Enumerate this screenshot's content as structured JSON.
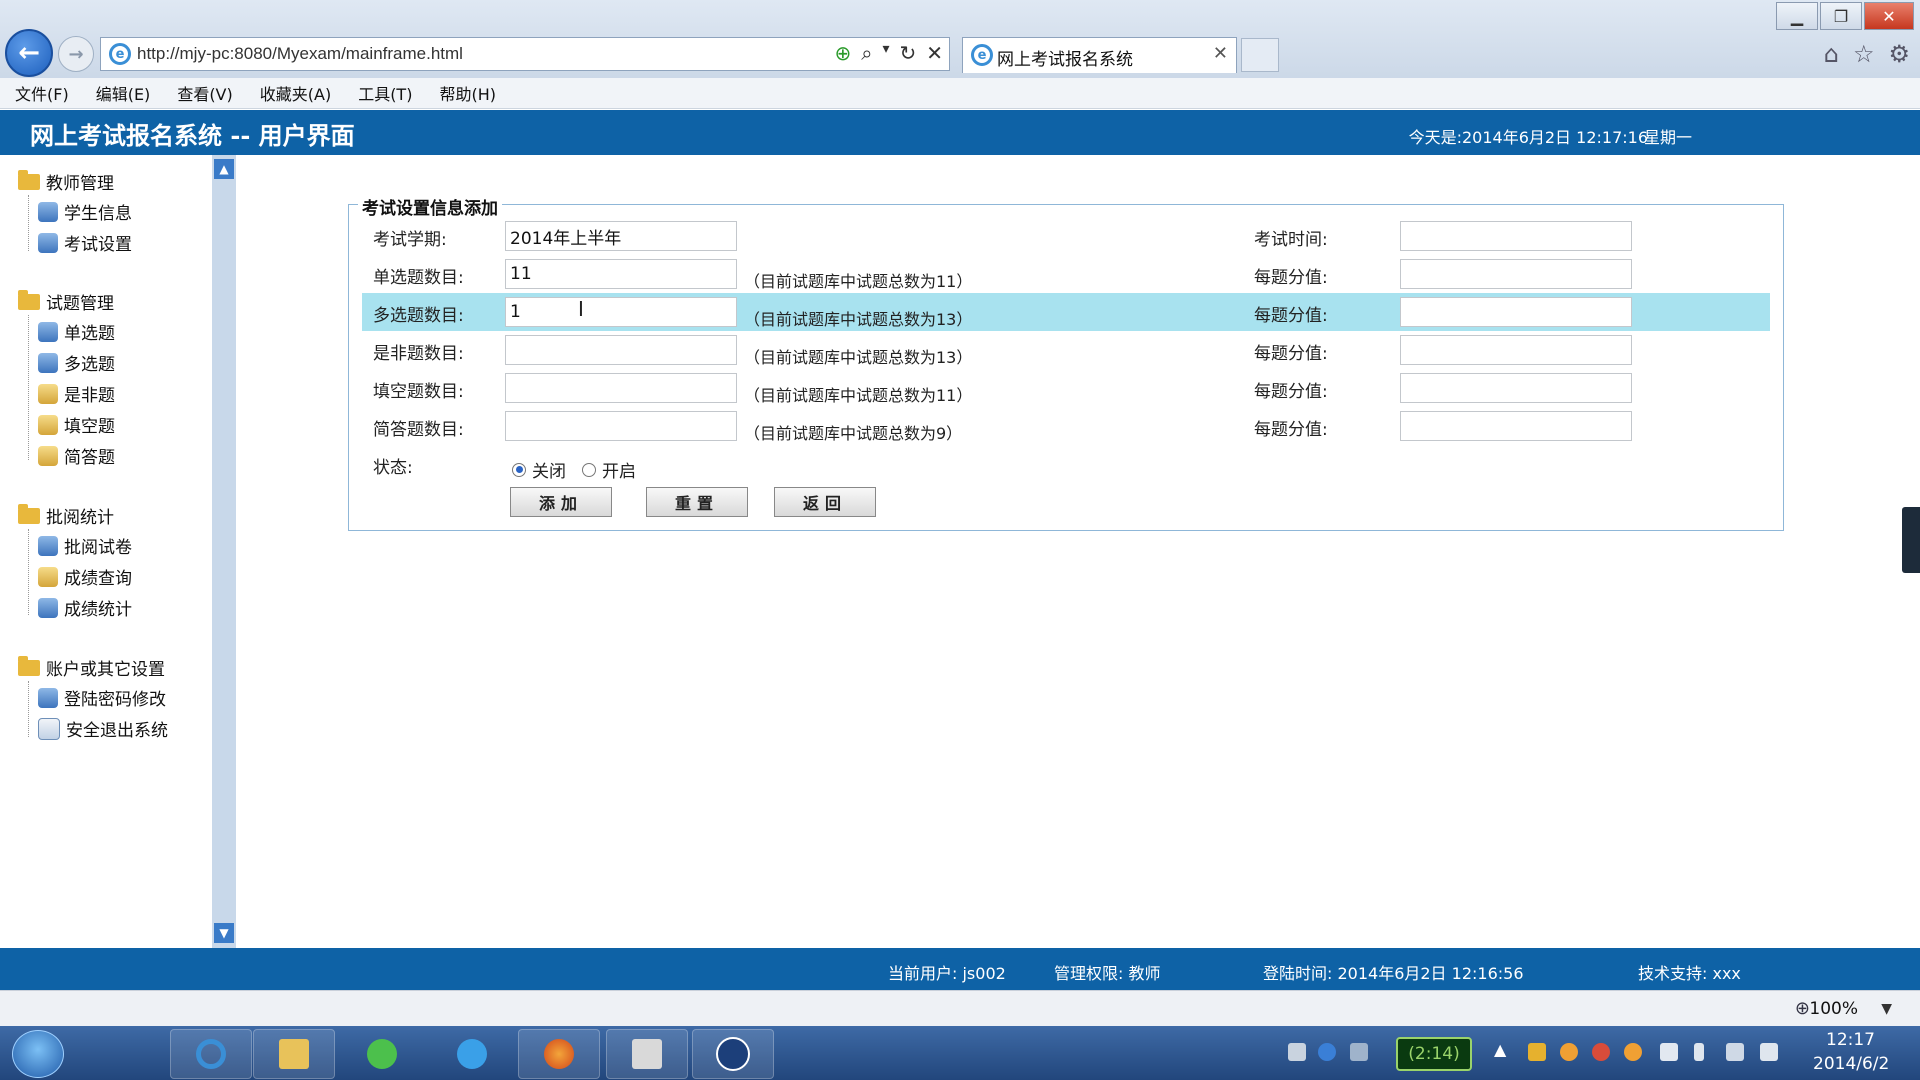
{
  "browser": {
    "url": "http://mjy-pc:8080/Myexam/mainframe.html",
    "tab_title": "网上考试报名系统",
    "tab_close": "✕",
    "zoom": "100%"
  },
  "menu": [
    "文件(F)",
    "编辑(E)",
    "查看(V)",
    "收藏夹(A)",
    "工具(T)",
    "帮助(H)"
  ],
  "header": {
    "title": "网上考试报名系统 -- 用户界面",
    "date": "今天是:2014年6月2日   12:17:16",
    "weekday": "星期一"
  },
  "sidebar": {
    "groups": [
      {
        "label": "教师管理",
        "items": [
          "学生信息",
          "考试设置"
        ]
      },
      {
        "label": "试题管理",
        "items": [
          "单选题",
          "多选题",
          "是非题",
          "填空题",
          "简答题"
        ]
      },
      {
        "label": "批阅统计",
        "items": [
          "批阅试卷",
          "成绩查询",
          "成绩统计"
        ]
      },
      {
        "label": "账户或其它设置",
        "items": [
          "登陆密码修改",
          "安全退出系统"
        ]
      }
    ]
  },
  "form": {
    "legend": "考试设置信息添加",
    "semester_label": "考试学期:",
    "semester_value": "2014年上半年",
    "exam_time_label": "考试时间:",
    "rows": [
      {
        "label": "单选题数目:",
        "value": "11",
        "note": "（目前试题库中试题总数为11）",
        "score_label": "每题分值:"
      },
      {
        "label": "多选题数目:",
        "value": "1",
        "note": "（目前试题库中试题总数为13）",
        "score_label": "每题分值:"
      },
      {
        "label": "是非题数目:",
        "value": "",
        "note": "（目前试题库中试题总数为13）",
        "score_label": "每题分值:"
      },
      {
        "label": "填空题数目:",
        "value": "",
        "note": "（目前试题库中试题总数为11）",
        "score_label": "每题分值:"
      },
      {
        "label": "简答题数目:",
        "value": "",
        "note": "（目前试题库中试题总数为9）",
        "score_label": "每题分值:"
      }
    ],
    "status_label": "状态:",
    "status_options": [
      "关闭",
      "开启"
    ],
    "status_selected": "关闭",
    "buttons": {
      "add": "添加",
      "reset": "重置",
      "back": "返回"
    }
  },
  "statusbar": {
    "user": "当前用户: js002",
    "role": "管理权限: 教师",
    "login": "登陆时间: 2014年6月2日 12:16:56",
    "support": "技术支持: xxx"
  },
  "taskbar": {
    "timer": "(2:14)",
    "time": "12:17",
    "date": "2014/6/2"
  },
  "colors": {
    "header_blue": "#0e62a6",
    "highlight_row": "#a8e2ef",
    "form_border": "#8fb7d8"
  }
}
